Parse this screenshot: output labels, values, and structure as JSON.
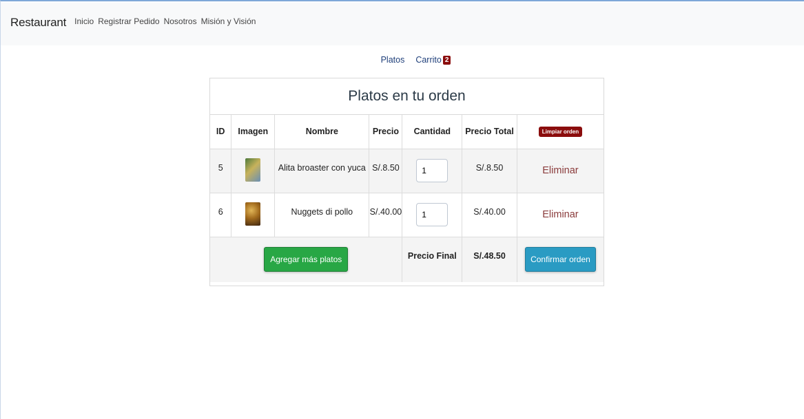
{
  "navbar": {
    "brand": "Restaurant",
    "links": [
      "Inicio",
      "Registrar Pedido",
      "Nosotros",
      "Misión y Visión"
    ]
  },
  "subnav": {
    "platos": "Platos",
    "carrito": "Carrito",
    "carrito_count": "2"
  },
  "order": {
    "title": "Platos en tu orden",
    "headers": [
      "ID",
      "Imagen",
      "Nombre",
      "Precio",
      "Cantidad",
      "Precio Total"
    ],
    "clear_label": "Limpiar orden",
    "items": [
      {
        "id": "5",
        "image_icon": "chicken-wings-photo",
        "name": "Alita broaster con yuca",
        "price": "S/.8.50",
        "qty": "1",
        "total": "S/.8.50",
        "remove": "Eliminar"
      },
      {
        "id": "6",
        "image_icon": "nuggets-photo",
        "name": "Nuggets di pollo",
        "price": "S/.40.00",
        "qty": "1",
        "total": "S/.40.00",
        "remove": "Eliminar"
      }
    ],
    "add_more_label": "Agregar más platos",
    "final_label": "Precio Final",
    "final_value": "S/.48.50",
    "confirm_label": "Confirmar orden"
  },
  "colors": {
    "badge": "#8b0d0d",
    "add_button": "#28a745",
    "confirm_button": "#2a9bc3",
    "link": "#1f3f7a"
  }
}
